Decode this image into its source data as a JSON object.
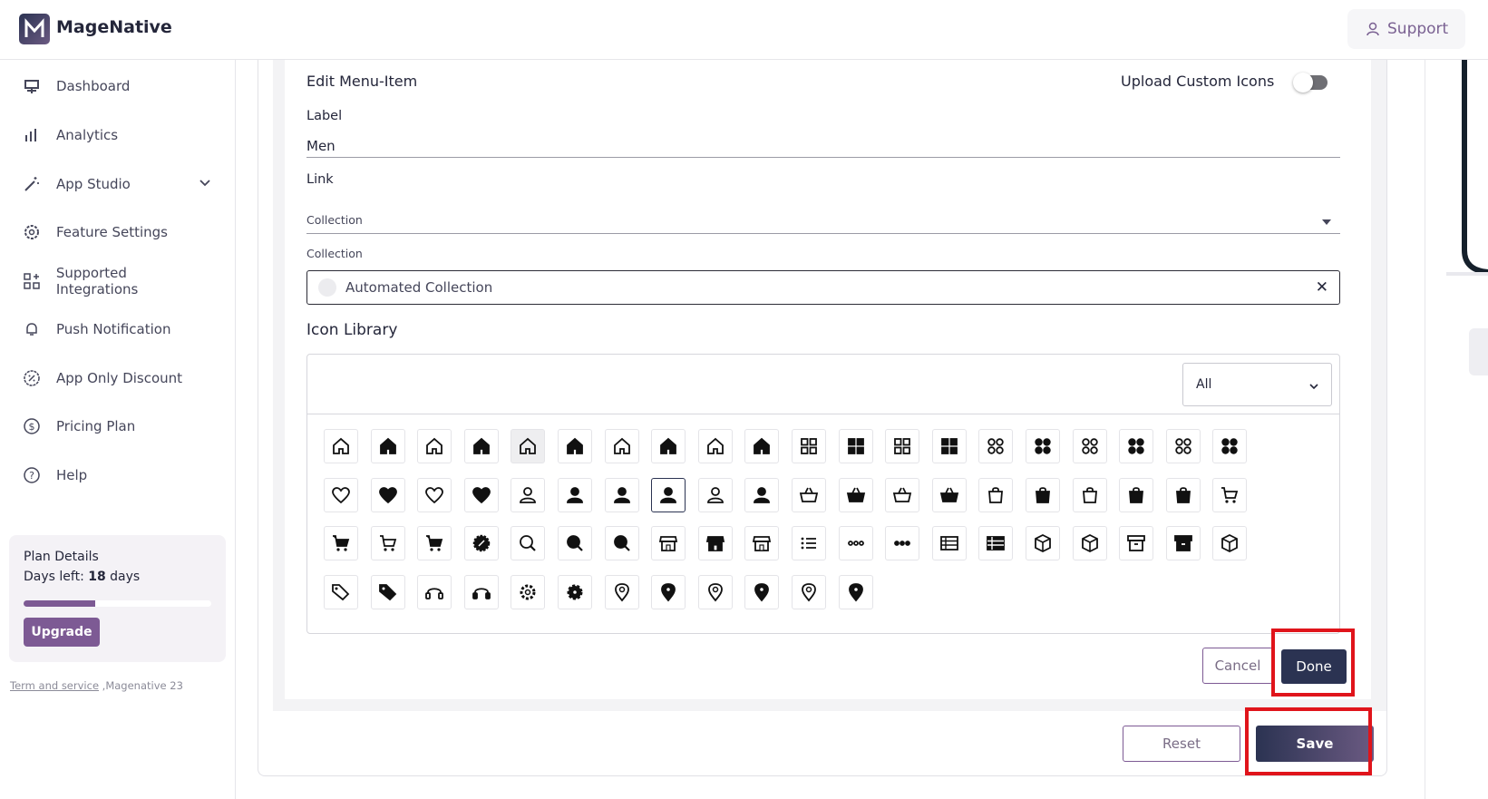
{
  "brand": {
    "name": "MageNative"
  },
  "header": {
    "support_label": "Support"
  },
  "sidebar": {
    "items": [
      {
        "label": "Dashboard",
        "icon": "monitor-icon"
      },
      {
        "label": "Analytics",
        "icon": "bar-chart-icon"
      },
      {
        "label": "App Studio",
        "icon": "magic-wand-icon"
      },
      {
        "label": "Feature Settings",
        "icon": "gear-icon"
      },
      {
        "label": "Supported Integrations",
        "icon": "grid-plus-icon"
      },
      {
        "label": "Push Notification",
        "icon": "bell-icon"
      },
      {
        "label": "App Only Discount",
        "icon": "discount-icon"
      },
      {
        "label": "Pricing Plan",
        "icon": "dollar-circle-icon"
      },
      {
        "label": "Help",
        "icon": "question-circle-icon"
      }
    ],
    "plan": {
      "title": "Plan Details",
      "days_prefix": "Days left: ",
      "days_value": "18",
      "days_suffix": " days",
      "progress_fraction": 0.38,
      "upgrade_label": "Upgrade"
    },
    "footer": {
      "link_text": "Term and service",
      "rest_text": " ,Magenative 23"
    }
  },
  "form": {
    "title": "Edit Menu-Item",
    "upload_custom_icons_label": "Upload Custom Icons",
    "upload_custom_icons_on": false,
    "label_caption": "Label",
    "label_value": "Men",
    "link_caption": "Link",
    "link_select_value": "Collection",
    "collection_caption": "Collection",
    "collection_value": "Automated Collection",
    "icon_library_title": "Icon Library",
    "icon_filter_value": "All",
    "cancel_label": "Cancel",
    "done_label": "Done",
    "reset_label": "Reset",
    "save_label": "Save"
  },
  "icon_library": {
    "rows": [
      [
        "home-outline-icon",
        "home-filled-icon",
        "home-outline-icon",
        "home-filled-icon",
        "home-outline-icon",
        "home-filled-icon",
        "home-outline-icon",
        "home-filled-icon",
        "home-outline-icon",
        "home-filled-icon",
        "grid-outline-icon",
        "grid-filled-icon",
        "grid-outline-icon",
        "grid-filled-icon",
        "grid-round-outline-icon",
        "grid-round-filled-icon",
        "grid-round-outline-icon",
        "grid-round-filled-icon",
        "grid-round-outline-icon",
        "grid-round-filled-icon"
      ],
      [
        "heart-outline-icon",
        "heart-filled-icon",
        "heart-outline-icon",
        "heart-filled-icon",
        "user-outline-icon",
        "user-filled-icon",
        "user-filled-icon",
        "user-filled-icon",
        "user-outline-icon",
        "user-filled-icon",
        "basket-outline-icon",
        "basket-filled-icon",
        "basket-outline-icon",
        "basket-filled-icon",
        "bag-outline-icon",
        "bag-filled-icon",
        "bag-outline-icon",
        "bag-filled-icon",
        "bag-filled-icon",
        "cart-outline-icon"
      ],
      [
        "cart-filled-icon",
        "cart-outline-icon",
        "cart-filled-icon",
        "badge-icon",
        "search-outline-icon",
        "search-filled-icon",
        "search-filled-icon",
        "store-outline-icon",
        "store-filled-icon",
        "store-outline-icon",
        "list-icon",
        "more-outline-icon",
        "more-filled-icon",
        "list-outline-icon",
        "list-filled-icon",
        "box-outline-icon",
        "box-outline-icon",
        "archive-outline-icon",
        "archive-filled-icon",
        "box-outline-icon"
      ],
      [
        "tag-outline-icon",
        "tag-filled-icon",
        "headset-outline-icon",
        "headset-filled-icon",
        "settings-outline-icon",
        "settings-filled-icon",
        "pin-outline-icon",
        "pin-filled-icon",
        "pin-outline-icon",
        "pin-filled-icon",
        "pin-outline-icon",
        "pin-filled-icon"
      ]
    ],
    "selected": [
      1,
      7
    ],
    "hovered": [
      0,
      4
    ]
  },
  "colors": {
    "accent": "#7d5a94",
    "primary": "#2b3352",
    "highlight": "#e0141b"
  }
}
